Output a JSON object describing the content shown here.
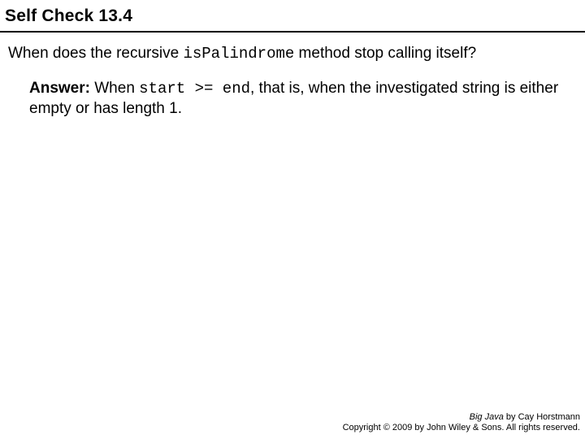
{
  "title": "Self Check 13.4",
  "question": {
    "part1": "When does the recursive ",
    "code": "isPalindrome",
    "part2": " method stop calling itself?"
  },
  "answer": {
    "label": "Answer:",
    "part1": " When ",
    "code": "start >= end",
    "part2": ", that is, when the investigated string is either empty or has length 1."
  },
  "footer": {
    "book": "Big Java",
    "author": " by Cay Horstmann",
    "copyright": "Copyright © 2009 by John Wiley & Sons. All rights reserved."
  }
}
